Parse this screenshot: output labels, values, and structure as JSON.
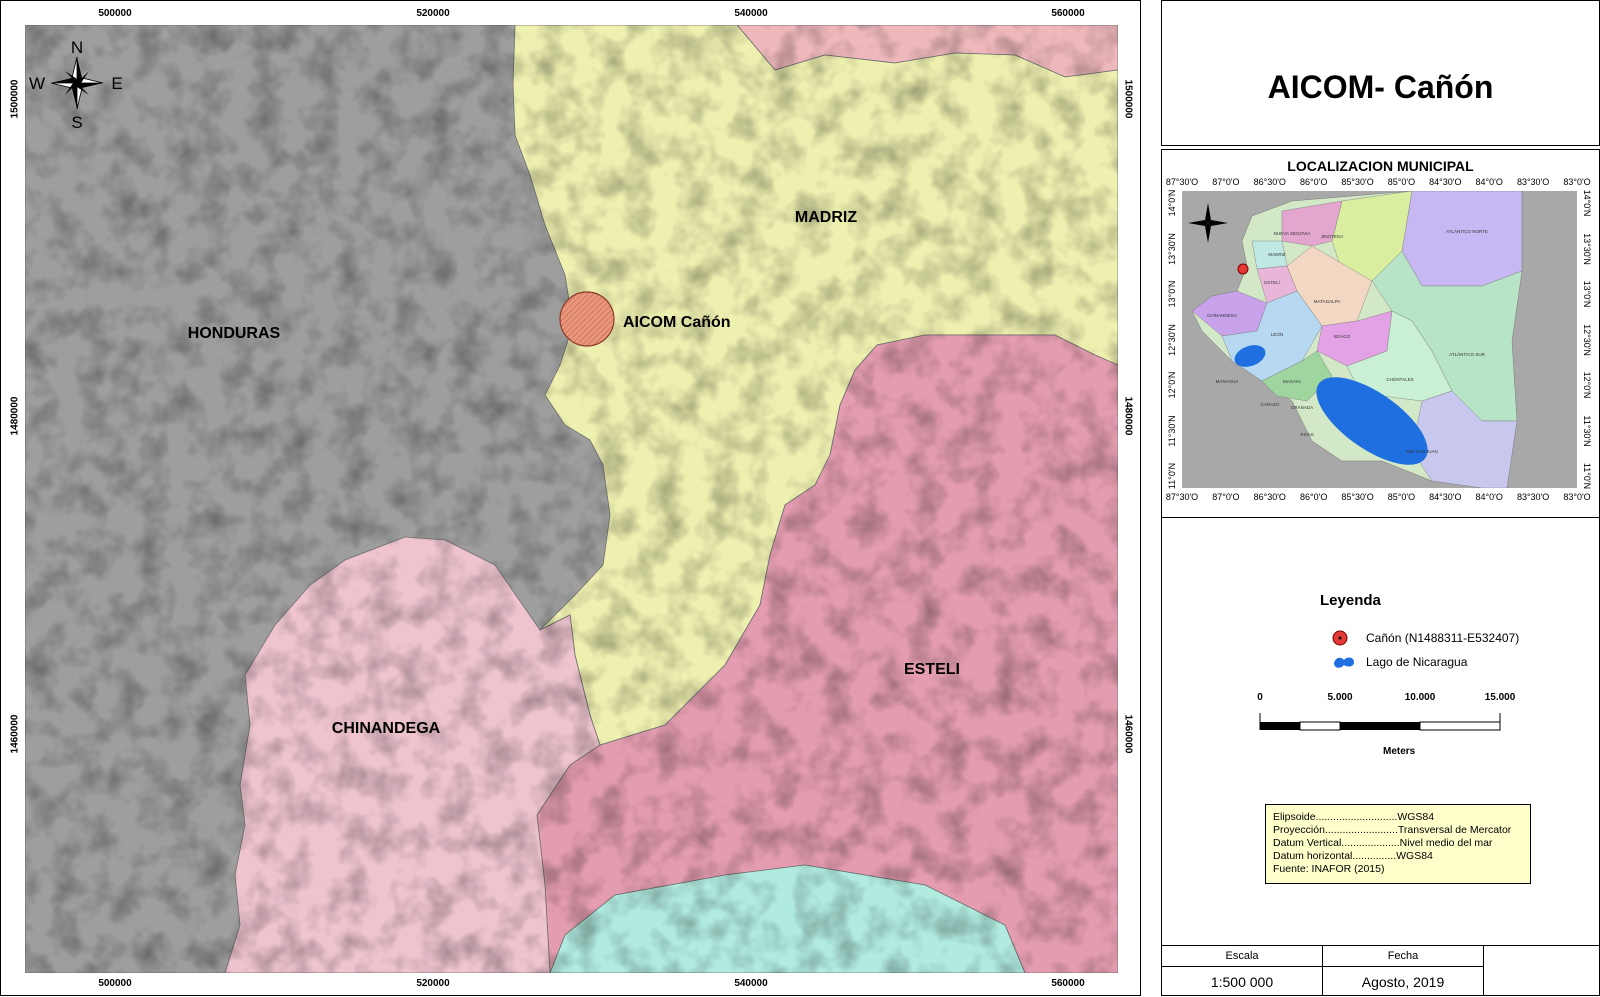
{
  "map": {
    "top_ticks": [
      "500000",
      "520000",
      "540000",
      "560000"
    ],
    "bottom_ticks": [
      "500000",
      "520000",
      "540000",
      "560000"
    ],
    "left_ticks": [
      "1500000",
      "1480000",
      "1460000"
    ],
    "right_ticks": [
      "1500000",
      "1480000",
      "1460000"
    ],
    "compass": {
      "n": "N",
      "s": "S",
      "e": "E",
      "w": "W"
    },
    "regions": {
      "honduras": "HONDURAS",
      "madriz": "MADRIZ",
      "esteli": "ESTELI",
      "chinandega": "CHINANDEGA"
    },
    "site_label": "AICOM Cañón",
    "colors": {
      "honduras": "#9e9e9e",
      "madriz": "#eef0b0",
      "esteli": "#e49db0",
      "chinandega": "#efc4cf",
      "north_pink": "#efb8bc",
      "south_cyan": "#b1ebe0",
      "site": "#e9967a"
    }
  },
  "title": "AICOM- Cañón",
  "inset": {
    "title": "LOCALIZACION MUNICIPAL",
    "top_ticks": [
      "87°30'O",
      "87°0'O",
      "86°30'O",
      "86°0'O",
      "85°30'O",
      "85°0'O",
      "84°30'O",
      "84°0'O",
      "83°30'O",
      "83°0'O"
    ],
    "bottom_ticks": [
      "87°30'O",
      "87°0'O",
      "86°30'O",
      "86°0'O",
      "85°30'O",
      "85°0'O",
      "84°30'O",
      "84°0'O",
      "83°30'O",
      "83°0'O"
    ],
    "left_ticks": [
      "14°0'N",
      "13°30'N",
      "13°0'N",
      "12°30'N",
      "12°0'N",
      "11°30'N",
      "11°0'N"
    ],
    "right_ticks": [
      "14°0'N",
      "13°30'N",
      "13°0'N",
      "12°30'N",
      "12°0'N",
      "11°30'N",
      "11°0'N"
    ],
    "dept_labels": [
      "NUEVA SEGOVIA",
      "JINOTEGA",
      "ATLÁNTICO NORTE",
      "MADRIZ",
      "ESTELÍ",
      "MATAGALPA",
      "CHINANDEGA",
      "LEÓN",
      "BOACO",
      "ATLÁNTICO SUR",
      "MANAGUA",
      "MASAYA",
      "CARAZO",
      "GRANADA",
      "CHONTALES",
      "RIVAS",
      "RÍO SAN JUAN"
    ]
  },
  "legend": {
    "title": "Leyenda",
    "items": [
      {
        "label": "Cañón (N1488311-E532407)",
        "icon": "red-point-icon",
        "color": "#e53935"
      },
      {
        "label": "Lago de Nicaragua",
        "icon": "lake-icon",
        "color": "#1f6fe0"
      }
    ],
    "scale_labels": [
      "0",
      "5.000",
      "10.000",
      "15.000"
    ],
    "scale_units": "Meters"
  },
  "metadata": [
    {
      "key": "Elipsoide",
      "dots": "............................",
      "value": "WGS84"
    },
    {
      "key": "Proyección",
      "dots": ".........................",
      "value": "Transversal de Mercator"
    },
    {
      "key": "Datum Vertical",
      "dots": "....................",
      "value": "Nivel medio del mar"
    },
    {
      "key": "Datum horizontal",
      "dots": "...............",
      "value": "WGS84"
    },
    {
      "key": "Fuente",
      "dots": "",
      "value": ": INAFOR (2015)"
    }
  ],
  "footer": {
    "scale_header": "Escala",
    "scale_value": "1:500 000",
    "date_header": "Fecha",
    "date_value": "Agosto, 2019"
  }
}
